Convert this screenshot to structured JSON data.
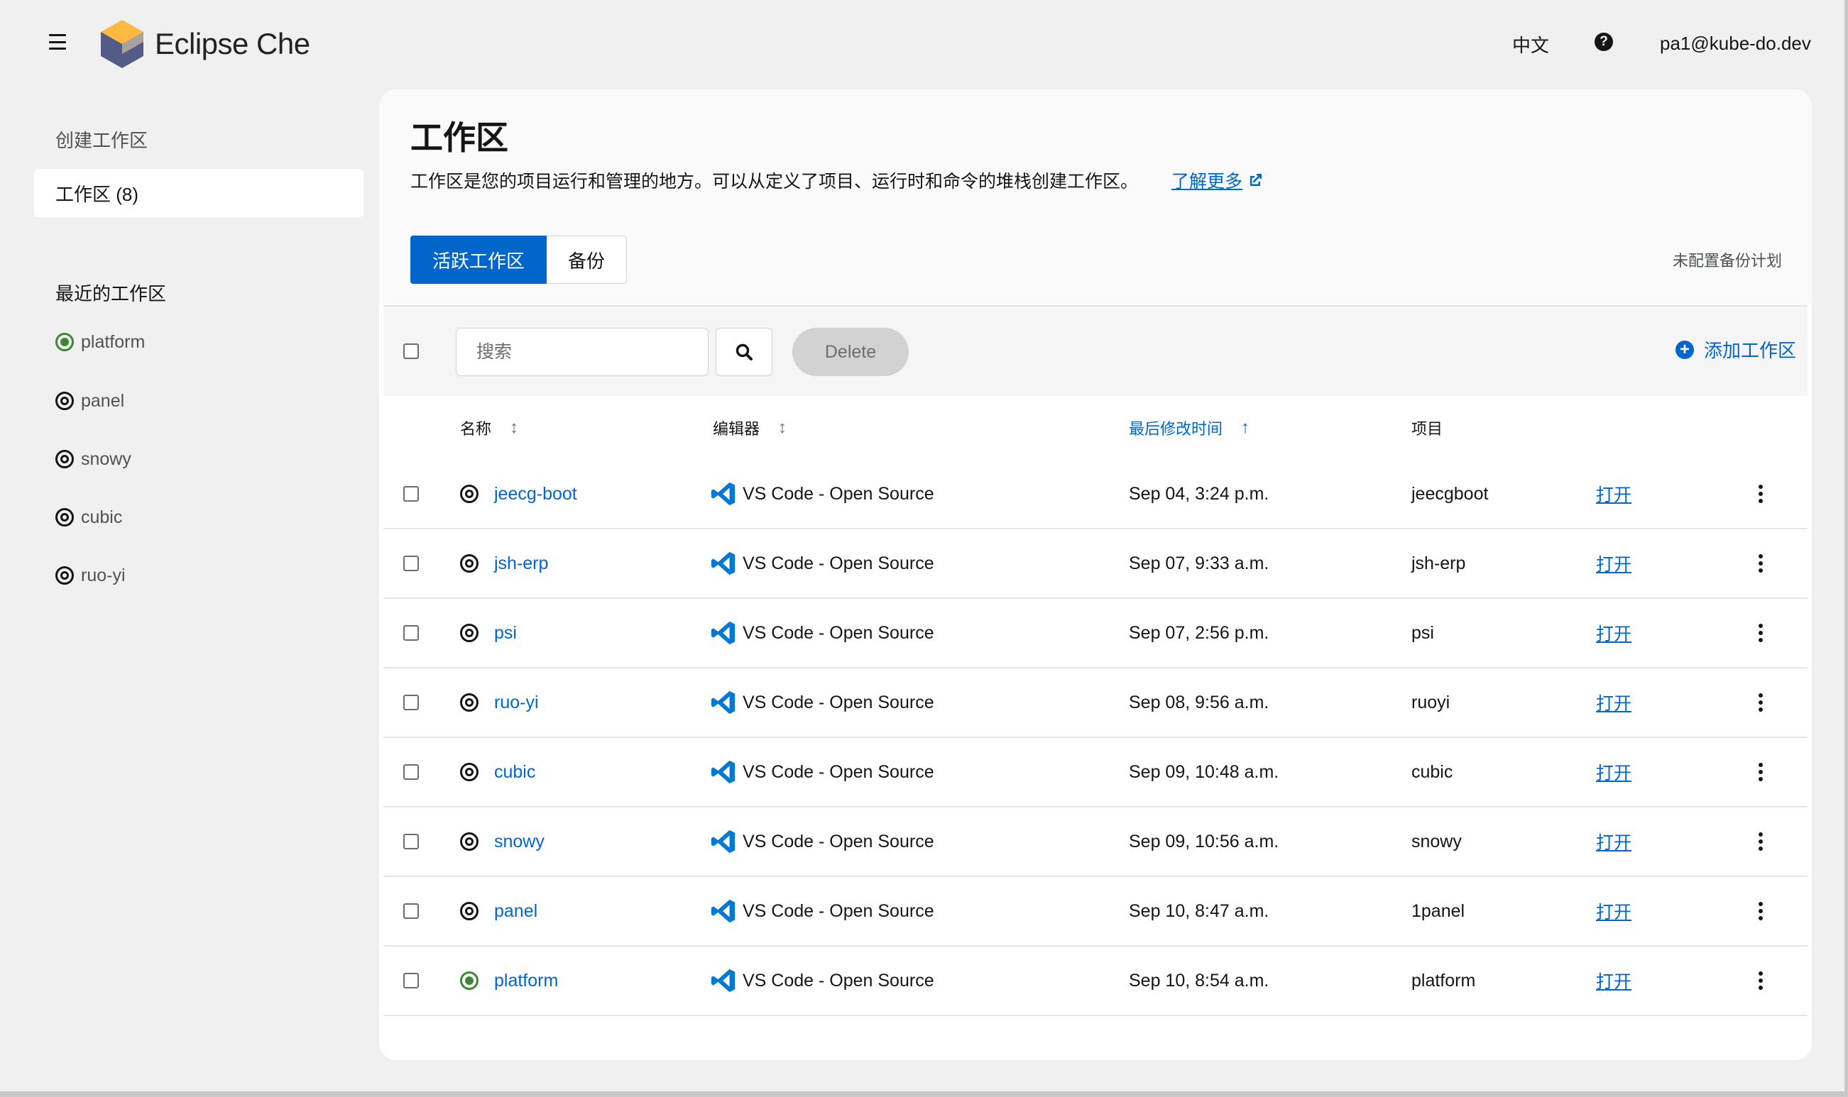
{
  "masthead": {
    "brand": "Eclipse Che",
    "language": "中文",
    "help_glyph": "?",
    "user": "pa1@kube-do.dev"
  },
  "sidebar": {
    "create_link": "创建工作区",
    "workspaces_link": "工作区 (8)",
    "recent_title": "最近的工作区",
    "recent": [
      {
        "name": "platform",
        "status": "running"
      },
      {
        "name": "panel",
        "status": "stopped"
      },
      {
        "name": "snowy",
        "status": "stopped"
      },
      {
        "name": "cubic",
        "status": "stopped"
      },
      {
        "name": "ruo-yi",
        "status": "stopped"
      }
    ]
  },
  "page": {
    "title": "工作区",
    "description": "工作区是您的项目运行和管理的地方。可以从定义了项目、运行时和命令的堆栈创建工作区。",
    "learn_more": "了解更多",
    "tabs": [
      "活跃工作区",
      "备份"
    ],
    "backup_note": "未配置备份计划"
  },
  "toolbar": {
    "search_placeholder": "搜索",
    "delete_label": "Delete",
    "add_label": "添加工作区"
  },
  "table": {
    "headers": {
      "name": "名称",
      "editor": "编辑器",
      "modified": "最后修改时间",
      "project": "项目"
    },
    "rows": [
      {
        "name": "jeecg-boot",
        "status": "stopped",
        "editor": "VS Code - Open Source",
        "modified": "Sep 04, 3:24 p.m.",
        "project": "jeecgboot",
        "action": "打开"
      },
      {
        "name": "jsh-erp",
        "status": "stopped",
        "editor": "VS Code - Open Source",
        "modified": "Sep 07, 9:33 a.m.",
        "project": "jsh-erp",
        "action": "打开"
      },
      {
        "name": "psi",
        "status": "stopped",
        "editor": "VS Code - Open Source",
        "modified": "Sep 07, 2:56 p.m.",
        "project": "psi",
        "action": "打开"
      },
      {
        "name": "ruo-yi",
        "status": "stopped",
        "editor": "VS Code - Open Source",
        "modified": "Sep 08, 9:56 a.m.",
        "project": "ruoyi",
        "action": "打开"
      },
      {
        "name": "cubic",
        "status": "stopped",
        "editor": "VS Code - Open Source",
        "modified": "Sep 09, 10:48 a.m.",
        "project": "cubic",
        "action": "打开"
      },
      {
        "name": "snowy",
        "status": "stopped",
        "editor": "VS Code - Open Source",
        "modified": "Sep 09, 10:56 a.m.",
        "project": "snowy",
        "action": "打开"
      },
      {
        "name": "panel",
        "status": "stopped",
        "editor": "VS Code - Open Source",
        "modified": "Sep 10, 8:47 a.m.",
        "project": "1panel",
        "action": "打开"
      },
      {
        "name": "platform",
        "status": "running",
        "editor": "VS Code - Open Source",
        "modified": "Sep 10, 8:54 a.m.",
        "project": "platform",
        "action": "打开"
      }
    ]
  },
  "colors": {
    "accent": "#0066cc",
    "running": "#3e8635",
    "vscode": "#0078d4"
  }
}
